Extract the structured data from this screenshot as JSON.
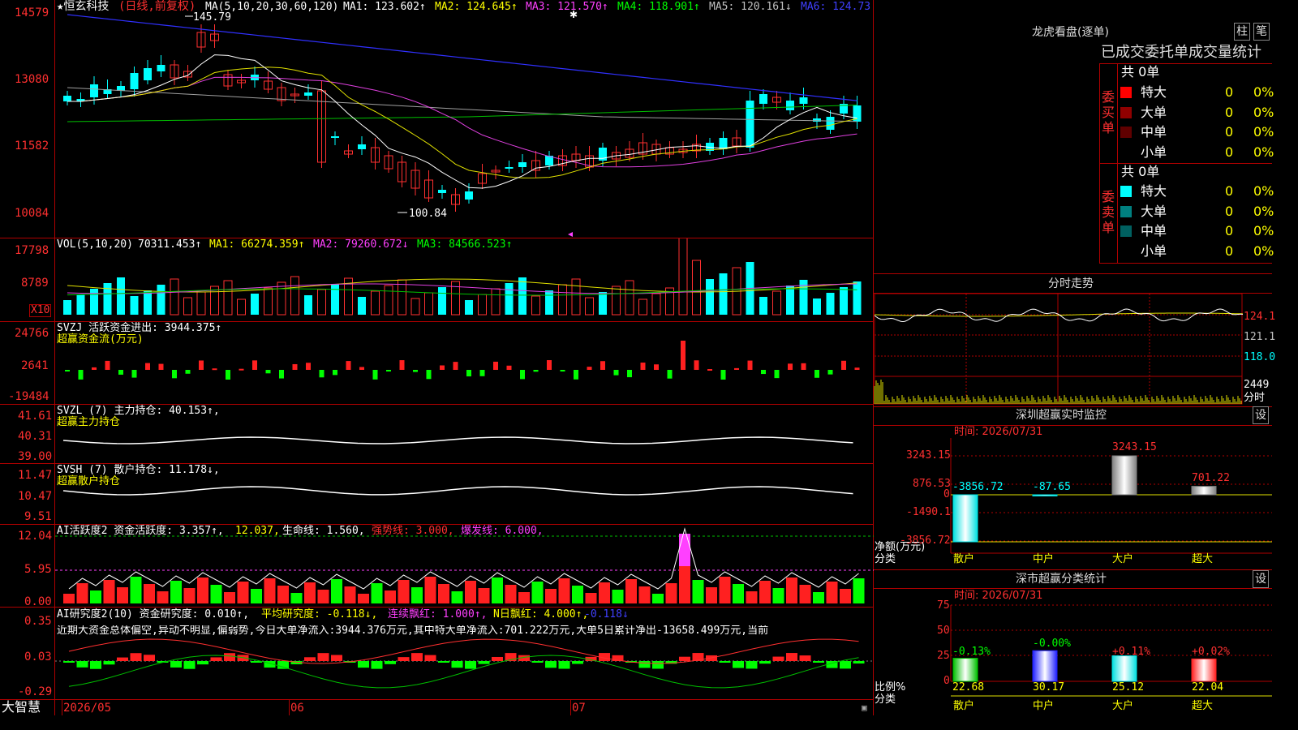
{
  "main": {
    "stock_name": "★恒玄科技",
    "period": "(日线,前复权)",
    "ma_label": "MA(5,10,20,30,60,120)",
    "ma_values": [
      {
        "label": "MA1: 123.602↑",
        "color": "#ffffff"
      },
      {
        "label": "MA2: 124.645↑",
        "color": "#ffff00"
      },
      {
        "label": "MA3: 121.570↑",
        "color": "#ff40ff"
      },
      {
        "label": "MA4: 118.901↑",
        "color": "#00ff00"
      },
      {
        "label": "MA5: 120.161↓",
        "color": "#c0c0c0"
      },
      {
        "label": "MA6: 124.73",
        "color": "#4040ff"
      }
    ],
    "y_ticks": [
      "14579",
      "13080",
      "11582",
      "10084"
    ],
    "high_mark": "145.79",
    "low_mark": "100.84"
  },
  "vol": {
    "label": "VOL(5,10,20)",
    "value": "70311.453↑",
    "ma1": "MA1: 66274.359↑",
    "ma2": "MA2: 79260.672↓",
    "ma3": "MA3: 84566.523↑",
    "y_ticks": [
      "17798",
      "8789"
    ],
    "unit": "X10"
  },
  "svzj": {
    "label": "SVZJ  活跃资金进出: 3944.375↑",
    "sub": "超赢资金流(万元)",
    "y_ticks": [
      "24766",
      "2641",
      "-19484"
    ]
  },
  "svzl": {
    "label": "SVZL (7) 主力持仓: 40.153↑,",
    "sub": "超赢主力持仓",
    "y_ticks": [
      "41.61",
      "40.31",
      "39.00"
    ]
  },
  "svsh": {
    "label": "SVSH (7) 散户持仓: 11.178↓,",
    "sub": "超赢散户持仓",
    "y_ticks": [
      "11.47",
      "10.47",
      "9.51"
    ]
  },
  "ai1": {
    "label": "AI活跃度2 资金活跃度: 3.357↑,",
    "v2": "12.037,",
    "v3": "生命线: 1.560,",
    "v4": "强势线: 3.000,",
    "v5": "爆发线: 6.000,",
    "y_ticks": [
      "12.04",
      "5.95",
      "0.00"
    ]
  },
  "ai2": {
    "label": "AI研究度2(10) 资金研究度: 0.010↑,",
    "v2": "平均研究度: -0.118↓,",
    "v3": "连续飘红: 1.000↑,",
    "v4": "N日飘红: 4.000↑,",
    "v5": "-0.118↓",
    "comment": "近期大资金总体偏空,异动不明显,偏弱势,今日大单净流入:3944.376万元,其中特大单净流入:701.222万元,大单5日累计净出-13658.499万元,当前",
    "y_ticks": [
      "0.35",
      "0.03",
      "-0.29"
    ]
  },
  "bottom": {
    "brand": "大智慧",
    "dates": [
      "2026/05",
      "06",
      "07"
    ]
  },
  "right": {
    "dragon_title": "龙虎看盘(逐单)",
    "btn_col": "柱",
    "btn_pen": "笔",
    "tabs": "已成交委托单成交量统计",
    "buy": {
      "side": "委买单",
      "total": "共 0单",
      "rows": [
        {
          "name": "特大",
          "val": "0",
          "pct": "0%",
          "color": "#ff0000"
        },
        {
          "name": "大单",
          "val": "0",
          "pct": "0%",
          "color": "#900000"
        },
        {
          "name": "中单",
          "val": "0",
          "pct": "0%",
          "color": "#600000"
        },
        {
          "name": "小单",
          "val": "0",
          "pct": "0%",
          "color": "#000000"
        }
      ]
    },
    "sell": {
      "side": "委卖单",
      "total": "共 0单",
      "rows": [
        {
          "name": "特大",
          "val": "0",
          "pct": "0%",
          "color": "#00ffff"
        },
        {
          "name": "大单",
          "val": "0",
          "pct": "0%",
          "color": "#008080"
        },
        {
          "name": "中单",
          "val": "0",
          "pct": "0%",
          "color": "#006060"
        },
        {
          "name": "小单",
          "val": "0",
          "pct": "0%",
          "color": "#000000"
        }
      ]
    },
    "intraday": {
      "title": "分时走势",
      "ticks": [
        "124.1",
        "121.1",
        "118.0",
        "2449"
      ],
      "unit": "分时"
    },
    "monitor": {
      "title": "深圳超赢实时监控",
      "set": "设",
      "time": "时间: 2026/07/31",
      "y_ticks": [
        "3243.15",
        "876.53",
        "0",
        "-1490.1",
        "-3856.72"
      ],
      "bar_labels": [
        "-3856.72",
        "-87.65",
        "3243.15",
        "701.22"
      ],
      "axis_label": "净额(万元)",
      "cat_label": "分类",
      "categories": [
        "散户",
        "中户",
        "大户",
        "超大"
      ]
    },
    "stat": {
      "title": "深市超赢分类统计",
      "set": "设",
      "time": "时间: 2026/07/31",
      "y_ticks": [
        "75",
        "50",
        "25",
        "0"
      ],
      "changes": [
        "-0.13%",
        "-0.00%",
        "+0.11%",
        "+0.02%"
      ],
      "values": [
        "22.68",
        "30.17",
        "25.12",
        "22.04"
      ],
      "axis_label": "比例%",
      "cat_label": "分类",
      "categories": [
        "散户",
        "中户",
        "大户",
        "超大"
      ]
    }
  },
  "chart_data": [
    {
      "type": "bar",
      "title": "深圳超赢实时监控",
      "categories": [
        "散户",
        "中户",
        "大户",
        "超大"
      ],
      "values": [
        -3856.72,
        -87.65,
        3243.15,
        701.22
      ],
      "ylabel": "净额(万元)",
      "ylim": [
        -3856.72,
        3243.15
      ]
    },
    {
      "type": "bar",
      "title": "深市超赢分类统计",
      "categories": [
        "散户",
        "中户",
        "大户",
        "超大"
      ],
      "values": [
        22.68,
        30.17,
        25.12,
        22.04
      ],
      "ylabel": "比例%",
      "ylim": [
        0,
        75
      ]
    }
  ]
}
